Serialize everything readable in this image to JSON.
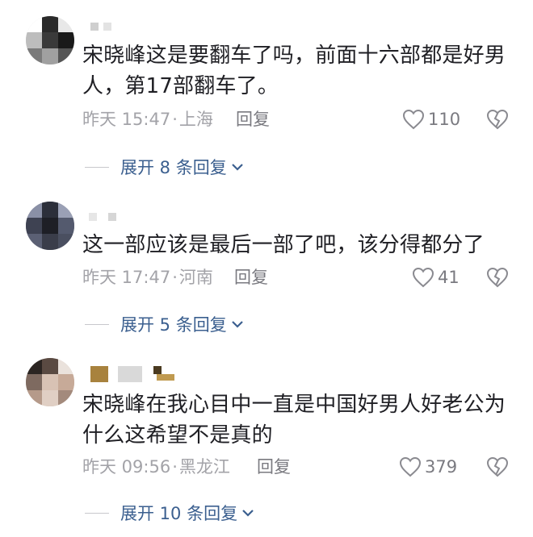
{
  "comments": [
    {
      "text": "宋晓峰这是要翻车了吗，前面十六部都是好男人，第17部翻车了。",
      "time": "昨天 15:47",
      "location": "上海",
      "reply_label": "回复",
      "likes": "110",
      "expand_label": "展开 8 条回复"
    },
    {
      "text": "这一部应该是最后一部了吧，该分得都分了",
      "time": "昨天 17:47",
      "location": "河南",
      "reply_label": "回复",
      "likes": "41",
      "expand_label": "展开 5 条回复"
    },
    {
      "text": "宋晓峰在我心目中一直是中国好男人好老公为什么这希望不是真的",
      "time": "昨天 09:56",
      "location": "黑龙江",
      "reply_label": "回复",
      "likes": "379",
      "expand_label": "展开 10 条回复"
    }
  ],
  "icons": {
    "like": "heart-outline-icon",
    "dislike": "broken-heart-icon",
    "expand": "chevron-down-icon"
  },
  "colors": {
    "text": "#1f1f24",
    "meta": "#a3a3a8",
    "expand": "#3b5f8f"
  }
}
